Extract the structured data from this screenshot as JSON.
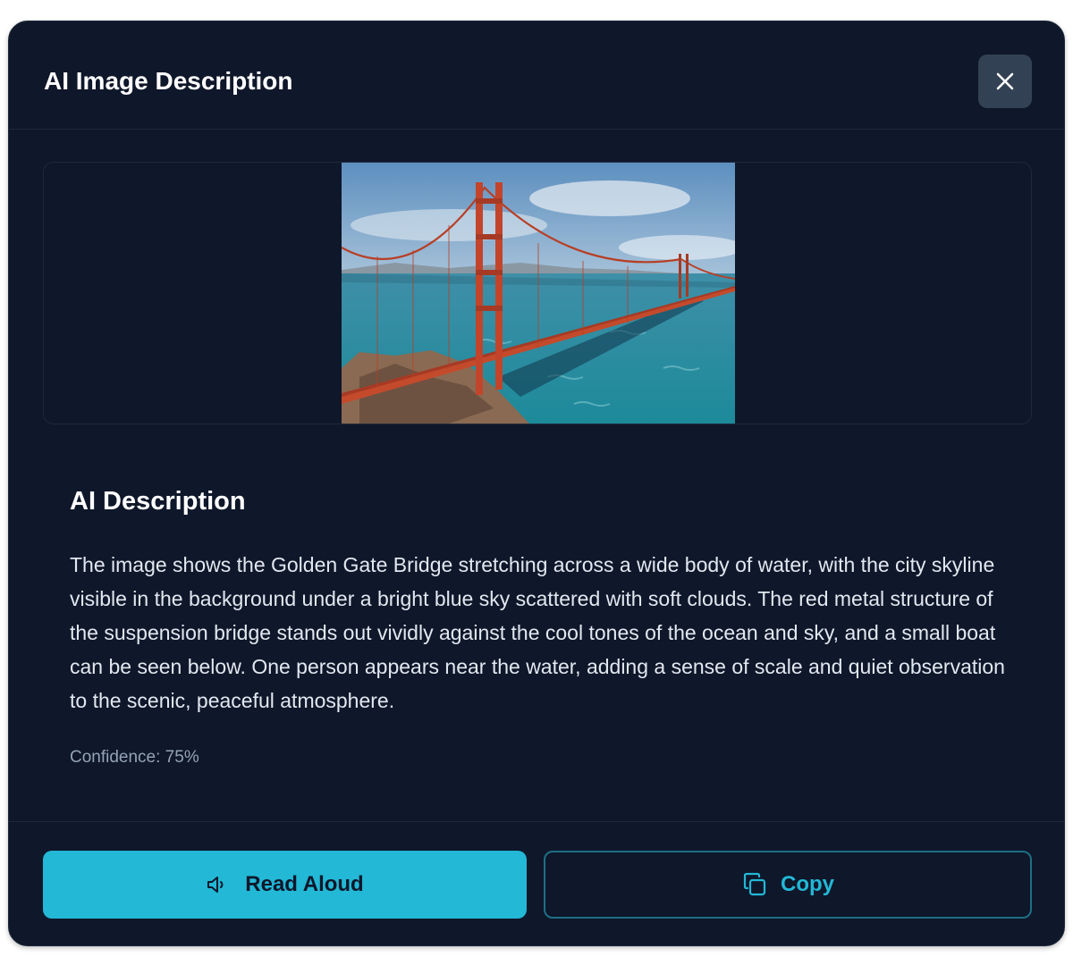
{
  "dialog": {
    "title": "AI Image Description",
    "close_icon": "close-icon"
  },
  "image": {
    "alt": "Golden Gate Bridge"
  },
  "description": {
    "heading": "AI Description",
    "text": "The image shows the Golden Gate Bridge stretching across a wide body of water, with the city skyline visible in the background under a bright blue sky scattered with soft clouds. The red metal structure of the suspension bridge stands out vividly against the cool tones of the ocean and sky, and a small boat can be seen below. One person appears near the water, adding a sense of scale and quiet observation to the scenic, peaceful atmosphere.",
    "confidence": "Confidence: 75%"
  },
  "actions": {
    "read_aloud_label": "Read Aloud",
    "read_aloud_icon": "speaker-icon",
    "copy_label": "Copy",
    "copy_icon": "copy-icon"
  },
  "colors": {
    "background": "#0f172a",
    "accent": "#22b8d6",
    "close_button": "#334155",
    "muted_text": "#94a3b8"
  }
}
